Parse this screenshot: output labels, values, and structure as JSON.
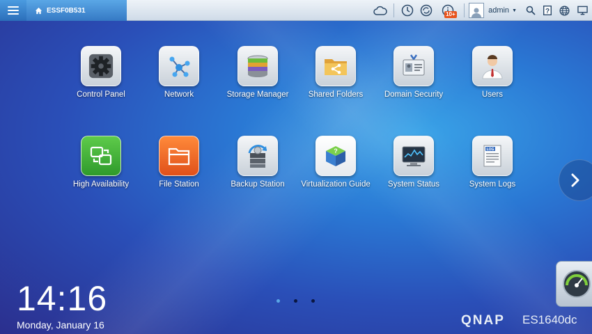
{
  "header": {
    "device_name": "ESSF0B531",
    "notification_badge": "10+",
    "user": "admin",
    "icons": [
      "menu-icon",
      "home-icon",
      "cloud-icon",
      "clock-icon",
      "sync-icon",
      "info-icon",
      "avatar-icon",
      "search-icon",
      "help-icon",
      "globe-icon",
      "monitor-icon"
    ]
  },
  "apps": [
    {
      "label": "Control Panel",
      "icon": "gear-icon"
    },
    {
      "label": "Network",
      "icon": "network-icon"
    },
    {
      "label": "Storage Manager",
      "icon": "storage-icon"
    },
    {
      "label": "Shared Folders",
      "icon": "folder-share-icon"
    },
    {
      "label": "Domain Security",
      "icon": "id-card-icon"
    },
    {
      "label": "Users",
      "icon": "user-icon"
    },
    {
      "label": "High Availability",
      "icon": "ha-icon"
    },
    {
      "label": "File Station",
      "icon": "folder-icon"
    },
    {
      "label": "Backup Station",
      "icon": "backup-icon"
    },
    {
      "label": "Virtualization Guide",
      "icon": "cube-icon"
    },
    {
      "label": "System Status",
      "icon": "status-monitor-icon"
    },
    {
      "label": "System Logs",
      "icon": "log-icon"
    }
  ],
  "clock": {
    "time": "14:16",
    "date": "Monday, January 16"
  },
  "pagination": {
    "total": 3,
    "active": 1
  },
  "brand": {
    "name": "QNAP",
    "model": "ES1640dc"
  },
  "colors": {
    "accent": "#3579c4",
    "badge": "#e8531c"
  }
}
